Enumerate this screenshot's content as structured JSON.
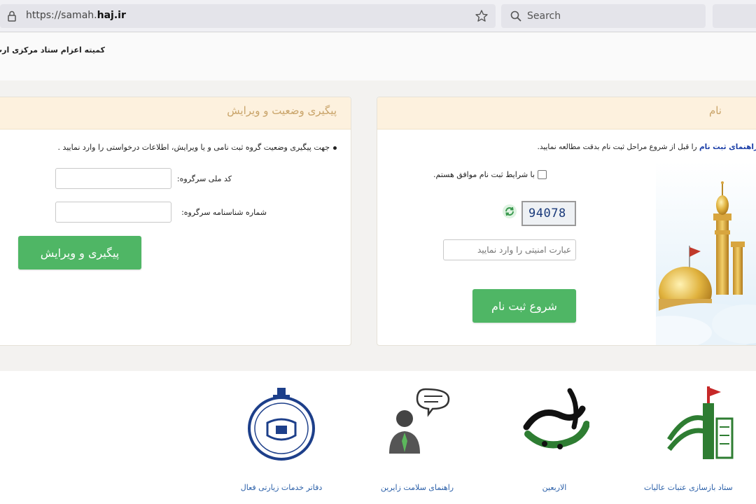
{
  "browser": {
    "url_prefix": "https://samah.",
    "url_host": "haj.ir",
    "search_placeholder": "Search"
  },
  "header": {
    "org_title": "کمیته اعزام ستاد مرکزی ارب"
  },
  "tracking": {
    "title": "پیگیری وضعیت و ویرایش",
    "description": "جهت پیگیری وضعیت گروه ثبت نامی و یا ویرایش، اطلاعات درخواستی را وارد نمایید .",
    "national_id_label": "کد ملی سرگروه:",
    "birth_cert_label": "شماره شناسنامه سرگروه:",
    "national_id_value": "",
    "birth_cert_value": "",
    "submit_label": "پیگیری و ویرایش"
  },
  "registration": {
    "title_fragment": "نام",
    "guide_link": "راهنمای ثبت نام",
    "guide_text": " را قبل از شروع مراحل ثبت نام بدقت مطالعه نمایید.",
    "terms_label": "با شرایط ثبت نام موافق هستم.",
    "captcha_code": "94078",
    "captcha_placeholder": "عبارت امنیتی را وارد نمایید",
    "start_label": "شروع ثبت نام"
  },
  "footer_links": [
    {
      "caption": "دفاتر خدمات زیارتی فعال",
      "icon": "seal-icon"
    },
    {
      "caption": "راهنمای سلامت زایرین",
      "icon": "health-guide-icon"
    },
    {
      "caption": "الاربعین",
      "icon": "arbaeen-logo-icon"
    },
    {
      "caption": "ستاد بازسازی عتبات عالیات",
      "icon": "reconstruction-logo-icon"
    }
  ],
  "colors": {
    "accent_green": "#4fb665",
    "panel_header": "#fdf1de",
    "panel_title": "#c9a46a",
    "link_blue": "#1c3fa8",
    "caption_blue": "#2a5fa8"
  }
}
